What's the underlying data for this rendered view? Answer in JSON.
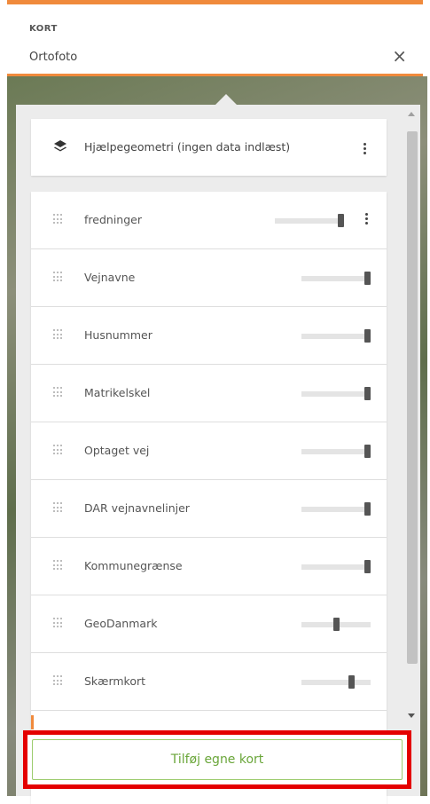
{
  "header": {
    "title": "KORT",
    "value": "Ortofoto",
    "close_label": "×"
  },
  "helper": {
    "label": "Hjælpegeometri (ingen data indlæst)",
    "icon": "layers-icon"
  },
  "layers": [
    {
      "name": "fredninger",
      "opacity": 1.0,
      "has_menu": true
    },
    {
      "name": "Vejnavne",
      "opacity": 1.0,
      "has_menu": false
    },
    {
      "name": "Husnummer",
      "opacity": 1.0,
      "has_menu": false
    },
    {
      "name": "Matrikelskel",
      "opacity": 1.0,
      "has_menu": false
    },
    {
      "name": "Optaget vej",
      "opacity": 1.0,
      "has_menu": false
    },
    {
      "name": "DAR vejnavnelinjer",
      "opacity": 1.0,
      "has_menu": false
    },
    {
      "name": "Kommunegrænse",
      "opacity": 1.0,
      "has_menu": false
    },
    {
      "name": "GeoDanmark",
      "opacity": 0.5,
      "has_menu": false
    },
    {
      "name": "Skærmkort",
      "opacity": 0.75,
      "has_menu": false
    }
  ],
  "add_button": {
    "label": "Tilføj egne kort"
  },
  "colors": {
    "accent": "#f08a3c",
    "highlight": "#e40000",
    "button_text": "#6aa63a"
  }
}
